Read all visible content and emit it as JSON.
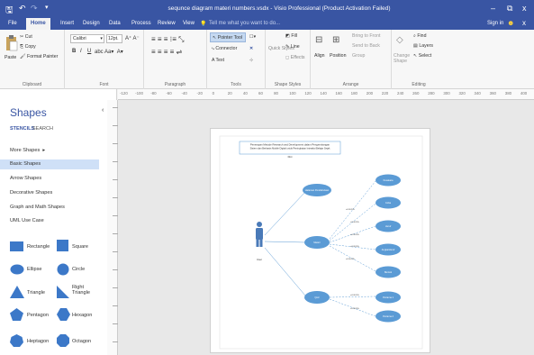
{
  "titlebar": {
    "title": "sequnce diagram materi numbers.vsdx - Visio Professional (Product Activation Failed)",
    "minimize": "–",
    "restore": "⧉",
    "close": "x"
  },
  "tabs": [
    {
      "label": "File"
    },
    {
      "label": "Home"
    },
    {
      "label": "Insert"
    },
    {
      "label": "Design"
    },
    {
      "label": "Data"
    },
    {
      "label": "Process"
    },
    {
      "label": "Review"
    },
    {
      "label": "View"
    }
  ],
  "tell_me": "Tell me what you want to do...",
  "signin": "Sign in",
  "ribbon": {
    "clipboard": {
      "paste": "Paste",
      "cut": "Cut",
      "copy": "Copy",
      "format_painter": "Format Painter",
      "label": "Clipboard"
    },
    "font": {
      "font": "Calibri",
      "size": "12pt.",
      "label": "Font",
      "bold": "B",
      "italic": "I",
      "underline": "U"
    },
    "paragraph": {
      "label": "Paragraph"
    },
    "tools": {
      "pointer": "Pointer Tool",
      "connector": "Connector",
      "text": "Text",
      "label": "Tools"
    },
    "shape_styles": {
      "fill": "Fill",
      "line": "Line",
      "effects": "Effects",
      "quick_styles": "Quick Styles",
      "label": "Shape Styles"
    },
    "arrange": {
      "align": "Align",
      "position": "Position",
      "bring_front": "Bring to Front",
      "send_back": "Send to Back",
      "group": "Group",
      "label": "Arrange"
    },
    "editing": {
      "change_shape": "Change Shape",
      "find": "Find",
      "layers": "Layers",
      "select": "Select",
      "label": "Editing"
    }
  },
  "shapes_panel": {
    "title": "Shapes",
    "stencils": "STENCILS",
    "search": "SEARCH",
    "items": [
      {
        "label": "More Shapes"
      },
      {
        "label": "Basic Shapes"
      },
      {
        "label": "Arrow Shapes"
      },
      {
        "label": "Decorative Shapes"
      },
      {
        "label": "Graph and Math Shapes"
      },
      {
        "label": "UML Use Case"
      }
    ],
    "shapes": [
      {
        "label": "Rectangle"
      },
      {
        "label": "Square"
      },
      {
        "label": "Ellipse"
      },
      {
        "label": "Circle"
      },
      {
        "label": "Triangle"
      },
      {
        "label": "Right Triangle"
      },
      {
        "label": "Pentagon"
      },
      {
        "label": "Hexagon"
      },
      {
        "label": "Heptagon"
      },
      {
        "label": "Octagon"
      }
    ]
  },
  "ruler": {
    "ticks": [
      "-120",
      "-100",
      "-80",
      "-60",
      "-40",
      "-20",
      "0",
      "20",
      "40",
      "60",
      "80",
      "100",
      "120",
      "140",
      "160",
      "180",
      "200",
      "220",
      "240",
      "260",
      "280",
      "300",
      "320",
      "340",
      "360",
      "380",
      "400"
    ]
  },
  "diagram": {
    "title_line1": "Penerapan Metode Research and Development dalam Pengembangan",
    "title_line2": "Sistem dan Berbasis Mobile Digital untuk Peningkatan Interaksi Belajar Sejak",
    "title_line3": "Dini",
    "actor_label": "User",
    "use_cases": [
      {
        "label": "Halaman Pendahuluan"
      },
      {
        "label": "Materi"
      },
      {
        "label": "Quiz"
      },
      {
        "label": "Kosakata"
      },
      {
        "label": "Coba"
      },
      {
        "label": "Huruf"
      },
      {
        "label": "Angka/Huruf"
      },
      {
        "label": "Bentuk"
      },
      {
        "label": "Pertama 1"
      },
      {
        "label": "Pertama 2"
      }
    ],
    "extend_label": "«extend»"
  },
  "colors": {
    "accent": "#3955a3",
    "usecase": "#5b9bd5",
    "actor": "#4a7ab8"
  }
}
